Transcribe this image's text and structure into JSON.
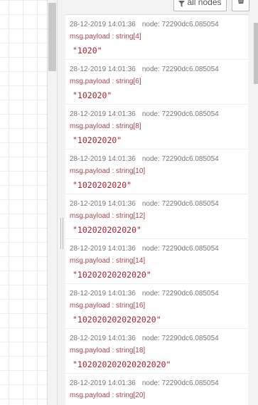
{
  "toolbar": {
    "filter_label": "all nodes",
    "filter_icon": "filter-icon",
    "clear_icon": "trash-icon"
  },
  "messages": [
    {
      "timestamp": "28-12-2019 14:01:36",
      "node": "node: 72290dc6.085054",
      "topic": "msg.payload : string[4]",
      "value": "\"1020\""
    },
    {
      "timestamp": "28-12-2019 14:01:36",
      "node": "node: 72290dc6.085054",
      "topic": "msg.payload : string[6]",
      "value": "\"102020\""
    },
    {
      "timestamp": "28-12-2019 14:01:36",
      "node": "node: 72290dc6.085054",
      "topic": "msg.payload : string[8]",
      "value": "\"10202020\""
    },
    {
      "timestamp": "28-12-2019 14:01:36",
      "node": "node: 72290dc6.085054",
      "topic": "msg.payload : string[10]",
      "value": "\"1020202020\""
    },
    {
      "timestamp": "28-12-2019 14:01:36",
      "node": "node: 72290dc6.085054",
      "topic": "msg.payload : string[12]",
      "value": "\"102020202020\""
    },
    {
      "timestamp": "28-12-2019 14:01:36",
      "node": "node: 72290dc6.085054",
      "topic": "msg.payload : string[14]",
      "value": "\"10202020202020\""
    },
    {
      "timestamp": "28-12-2019 14:01:36",
      "node": "node: 72290dc6.085054",
      "topic": "msg.payload : string[16]",
      "value": "\"1020202020202020\""
    },
    {
      "timestamp": "28-12-2019 14:01:36",
      "node": "node: 72290dc6.085054",
      "topic": "msg.payload : string[18]",
      "value": "\"102020202020202020\""
    },
    {
      "timestamp": "28-12-2019 14:01:36",
      "node": "node: 72290dc6.085054",
      "topic": "msg.payload : string[20]",
      "value": ""
    }
  ],
  "colors": {
    "topic": "#a6464b",
    "value": "#a6202b",
    "meta": "#777777"
  }
}
